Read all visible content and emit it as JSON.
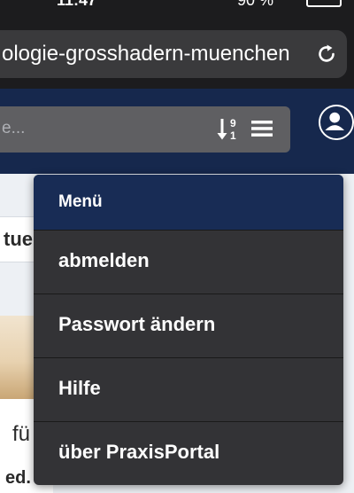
{
  "status_bar": {
    "time": "11:47",
    "battery_percent": "90 %"
  },
  "browser": {
    "url": "ologie-grosshadern-muenchen",
    "reload_icon": "reload-icon"
  },
  "header": {
    "search_placeholder": "e...",
    "sort_icon": "sort-numeric-icon",
    "menu_icon": "hamburger-icon",
    "user_icon": "user-icon"
  },
  "background_page": {
    "card_title_fragment": "tue",
    "text_fragment_1": "fü",
    "text_fragment_2": "ed."
  },
  "menu": {
    "header": "Menü",
    "items": [
      {
        "label": "abmelden"
      },
      {
        "label": "Passwort ändern"
      },
      {
        "label": "Hilfe"
      },
      {
        "label": "über PraxisPortal"
      }
    ]
  },
  "colors": {
    "header_navy": "#16284d",
    "menu_header_navy": "#182c55",
    "menu_background": "#333336",
    "browser_chrome": "#1c1c1e"
  }
}
